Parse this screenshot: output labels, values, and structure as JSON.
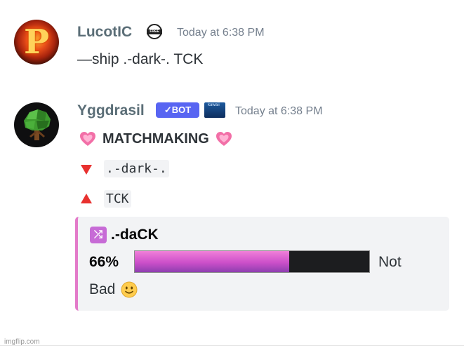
{
  "messages": [
    {
      "author": "LucotIC",
      "avatar_letter": "P",
      "badge_icon": "free-badge-icon",
      "badge_text": "FREE",
      "timestamp": "Today at 6:38 PM",
      "content": "—ship .-dark-. TCK"
    },
    {
      "author": "Yggdrasil",
      "avatar_icon": "tree-icon",
      "bot_tag": "✓BOT",
      "badge_icon": "yggdrasil-badge-icon",
      "badge_text": "kawaii",
      "timestamp": "Today at 6:38 PM",
      "title": "MATCHMAKING",
      "title_icon": "sparkling-heart-icon",
      "user_down": ".-dark-.",
      "user_up": "TCK",
      "embed": {
        "accent_color": "#e37ac9",
        "icon": "shuffle-icon",
        "title": ".-daCK",
        "percent_label": "66%",
        "percent_value": 66,
        "rating_text_1": "Not",
        "rating_text_2": "Bad",
        "rating_icon": "slightly-smiling-face-icon"
      }
    }
  ],
  "watermark": "imgflip.com",
  "colors": {
    "bot_tag": "#5865f2",
    "bar_fill": "#cc4fc9",
    "bar_empty": "#1c1d1f",
    "name": "#5b6e77",
    "timestamp": "#747f8d"
  }
}
